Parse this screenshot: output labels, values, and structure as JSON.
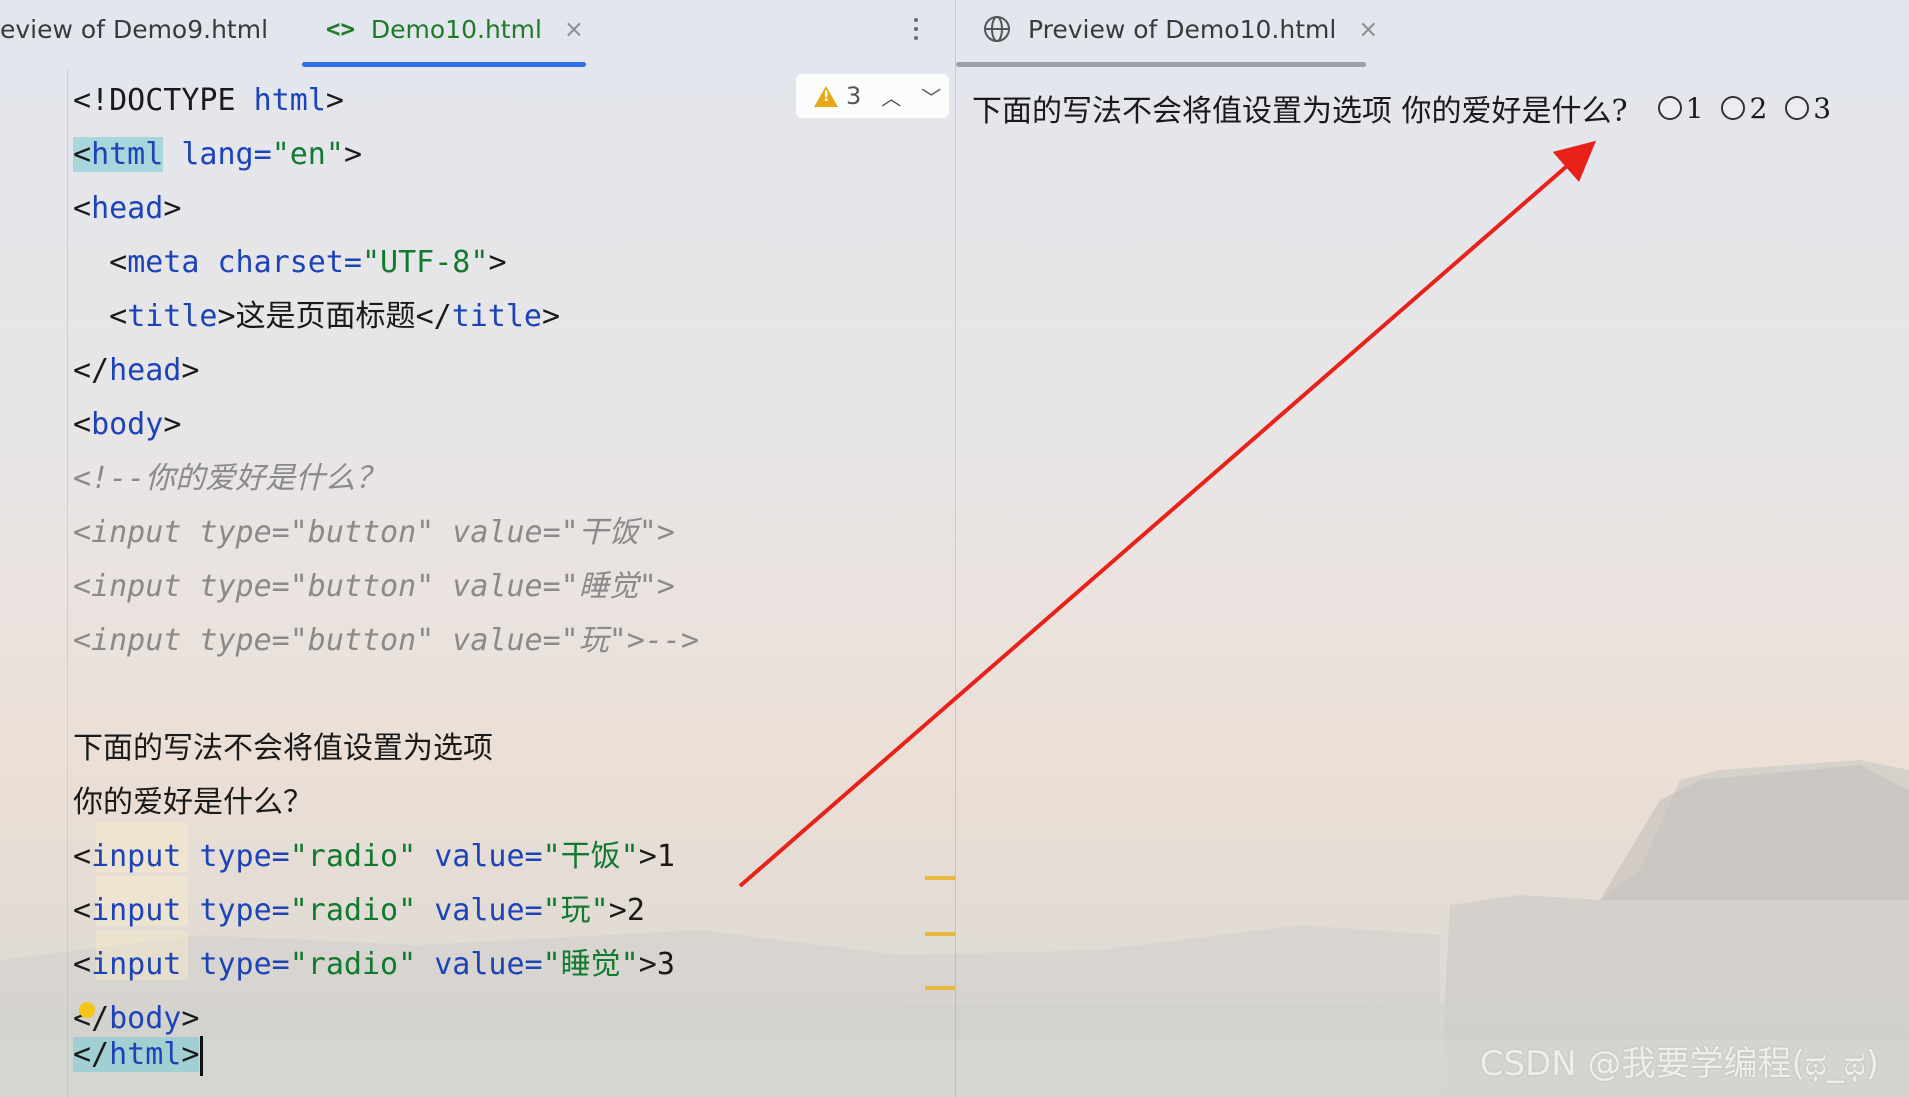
{
  "tabs": {
    "left": [
      {
        "label": "eview of Demo9.html",
        "active": false
      },
      {
        "label": "Demo10.html",
        "active": true,
        "icon": "code-icon"
      }
    ],
    "right": [
      {
        "label": "Preview of Demo10.html",
        "active": true,
        "icon": "globe-icon"
      }
    ],
    "close_glyph": "×"
  },
  "warnings": {
    "count": "3",
    "icon": "warning-icon",
    "up_icon": "chevron-up-icon",
    "down_icon": "chevron-down-icon"
  },
  "code": {
    "l1_open": "<!DOCTYPE ",
    "l1_tag": "html",
    "l1_close": ">",
    "l2_lt": "<",
    "l2_tag": "html",
    "l2_attr": "lang=",
    "l2_val": "\"en\"",
    "l2_gt": ">",
    "l3_lt": "<",
    "l3_tag": "head",
    "l3_gt": ">",
    "l4_lt": "<",
    "l4_tag": "meta",
    "l4_attr": "charset=",
    "l4_val": "\"UTF-8\"",
    "l4_gt": ">",
    "l5_lt": "<",
    "l5_tag": "title",
    "l5_gt": ">",
    "l5_text": "这是页面标题",
    "l5_lt2": "</",
    "l5_tag2": "title",
    "l5_gt2": ">",
    "l6_lt": "</",
    "l6_tag": "head",
    "l6_gt": ">",
    "l7_lt": "<",
    "l7_tag": "body",
    "l7_gt": ">",
    "l8": "<!--你的爱好是什么？",
    "l9": "<input type=\"button\" value=\"干饭\">",
    "l10": "<input type=\"button\" value=\"睡觉\">",
    "l11": "<input type=\"button\" value=\"玩\">-->",
    "l13": "下面的写法不会将值设置为选项",
    "l14": "你的爱好是什么？",
    "l15_lt": "<",
    "l15_tag": "input",
    "l15_attr1": "type=",
    "l15_val1": "\"radio\"",
    "l15_attr2": "value=",
    "l15_val2": "\"干饭\"",
    "l15_gt": ">",
    "l15_text": "1",
    "l16_lt": "<",
    "l16_tag": "input",
    "l16_attr1": "type=",
    "l16_val1": "\"radio\"",
    "l16_attr2": "value=",
    "l16_val2": "\"玩\"",
    "l16_gt": ">",
    "l16_text": "2",
    "l17_lt": "<",
    "l17_tag": "input",
    "l17_attr1": "type=",
    "l17_val1": "\"radio\"",
    "l17_attr2": "value=",
    "l17_val2": "\"睡觉\"",
    "l17_gt": ">",
    "l17_text": "3",
    "l18_lt": "<",
    "l18_slash": "/",
    "l18_tag": "body",
    "l18_gt": ">",
    "l19_lt": "</",
    "l19_tag": "html",
    "l19_gt": ">"
  },
  "preview": {
    "text": "下面的写法不会将值设置为选项 你的爱好是什么?",
    "radios": [
      "1",
      "2",
      "3"
    ]
  },
  "colors": {
    "active_tab": "#1f7a2a",
    "tab_underline": "#2f6fe0",
    "tag_name": "#1d43b8",
    "attr_value": "#127a2e",
    "comment": "#8a8a8a",
    "arrow": "#e8221b"
  },
  "watermark": "CSDN @我要学编程(ಥ_ಥ)"
}
